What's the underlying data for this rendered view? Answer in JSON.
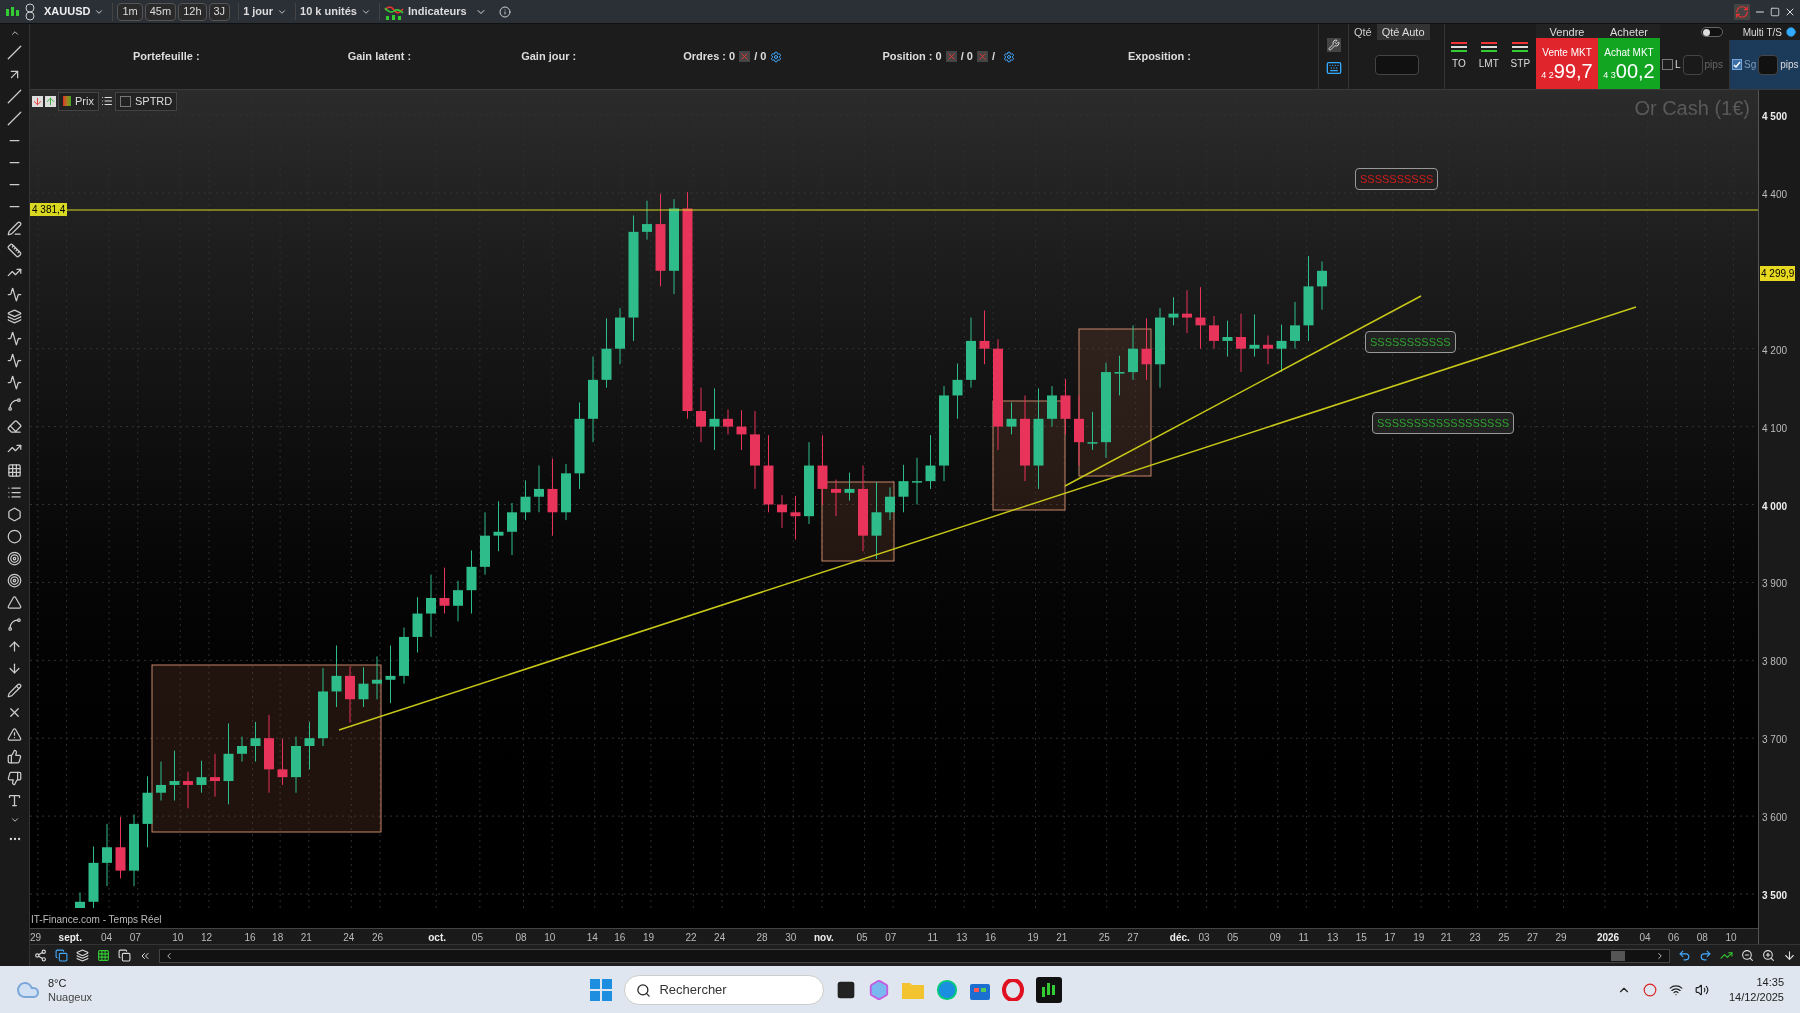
{
  "toolbar": {
    "symbol": "XAUUSD",
    "periods": [
      "1m",
      "45m",
      "12h",
      "3J"
    ],
    "timeframe": "1 jour",
    "units": "10 k unités",
    "indicators": "Indicateurs"
  },
  "info_bar": {
    "portfolio": "Portefeuille :",
    "unrealized": "Gain latent :",
    "day_gain": "Gain jour :",
    "orders": "Ordres : 0",
    "orders_2": "/ 0",
    "position": "Position : 0",
    "position_2": "/ 0",
    "position_3": "/",
    "exposure": "Exposition :"
  },
  "order_panel": {
    "qty_tabs": [
      {
        "label": "Qté",
        "selected": false
      },
      {
        "label": "Qté Auto",
        "selected": true
      }
    ],
    "order_types": [
      "TO",
      "LMT",
      "STP"
    ],
    "sell_label": "Vendre",
    "buy_label": "Acheter",
    "sell_button": "Vente MKT",
    "sell_prefix": "4 2",
    "sell_price": "99,7",
    "buy_button": "Achat MKT",
    "buy_prefix": "4 3",
    "buy_price": "00,2",
    "l_check": {
      "label": "L",
      "checked": false
    },
    "l_unit": "pips",
    "sg_check": {
      "label": "Sg",
      "checked": true
    },
    "sg_unit": "pips",
    "multi_ts": {
      "label": "Multi T/S",
      "on": false
    }
  },
  "chart_toolbar": {
    "price": "Prix",
    "sptrd": {
      "label": "SPTRD",
      "checked": false
    }
  },
  "chart": {
    "watermark": "Or Cash (1€)",
    "source": "IT-Finance.com - Temps Réel",
    "level_label": "4 381,4",
    "current_price": "4 299,9",
    "notes": [
      {
        "text": "SSSSSSSSSS",
        "color": "#d21c1c"
      },
      {
        "text": "SSSSSSSSSSS",
        "color": "#2ea12e"
      },
      {
        "text": "SSSSSSSSSSSSSSSSSS",
        "color": "#2ea12e"
      }
    ],
    "price_ticks": [
      {
        "label": "4 500",
        "bold": true
      },
      {
        "label": "4 400",
        "bold": false
      },
      {
        "label": "4 200",
        "bold": false
      },
      {
        "label": "4 100",
        "bold": false
      },
      {
        "label": "4 000",
        "bold": true
      },
      {
        "label": "3 900",
        "bold": false
      },
      {
        "label": "3 800",
        "bold": false
      },
      {
        "label": "3 700",
        "bold": false
      },
      {
        "label": "3 600",
        "bold": false
      },
      {
        "label": "3 500",
        "bold": true
      }
    ],
    "date_ticks": [
      {
        "label": "29",
        "bold": false
      },
      {
        "label": "sept.",
        "bold": true
      },
      {
        "label": "04",
        "bold": false
      },
      {
        "label": "07",
        "bold": false
      },
      {
        "label": "10",
        "bold": false
      },
      {
        "label": "12",
        "bold": false
      },
      {
        "label": "16",
        "bold": false
      },
      {
        "label": "18",
        "bold": false
      },
      {
        "label": "21",
        "bold": false
      },
      {
        "label": "24",
        "bold": false
      },
      {
        "label": "26",
        "bold": false
      },
      {
        "label": "oct.",
        "bold": true
      },
      {
        "label": "05",
        "bold": false
      },
      {
        "label": "08",
        "bold": false
      },
      {
        "label": "10",
        "bold": false
      },
      {
        "label": "14",
        "bold": false
      },
      {
        "label": "16",
        "bold": false
      },
      {
        "label": "19",
        "bold": false
      },
      {
        "label": "22",
        "bold": false
      },
      {
        "label": "24",
        "bold": false
      },
      {
        "label": "28",
        "bold": false
      },
      {
        "label": "30",
        "bold": false
      },
      {
        "label": "nov.",
        "bold": true
      },
      {
        "label": "05",
        "bold": false
      },
      {
        "label": "07",
        "bold": false
      },
      {
        "label": "11",
        "bold": false
      },
      {
        "label": "13",
        "bold": false
      },
      {
        "label": "16",
        "bold": false
      },
      {
        "label": "19",
        "bold": false
      },
      {
        "label": "21",
        "bold": false
      },
      {
        "label": "25",
        "bold": false
      },
      {
        "label": "27",
        "bold": false
      },
      {
        "label": "déc.",
        "bold": true
      },
      {
        "label": "03",
        "bold": false
      },
      {
        "label": "05",
        "bold": false
      },
      {
        "label": "09",
        "bold": false
      },
      {
        "label": "11",
        "bold": false
      },
      {
        "label": "13",
        "bold": false
      },
      {
        "label": "15",
        "bold": false
      },
      {
        "label": "17",
        "bold": false
      },
      {
        "label": "19",
        "bold": false
      },
      {
        "label": "21",
        "bold": false
      },
      {
        "label": "23",
        "bold": false
      },
      {
        "label": "25",
        "bold": false
      },
      {
        "label": "27",
        "bold": false
      },
      {
        "label": "29",
        "bold": false
      },
      {
        "label": "2026",
        "bold": true
      },
      {
        "label": "04",
        "bold": false
      },
      {
        "label": "06",
        "bold": false
      },
      {
        "label": "08",
        "bold": false
      },
      {
        "label": "10",
        "bold": false
      }
    ]
  },
  "taskbar": {
    "temperature": "8°C",
    "weather": "Nuageux",
    "search_placeholder": "Rechercher",
    "time": "14:35",
    "date": "14/12/2025"
  }
}
